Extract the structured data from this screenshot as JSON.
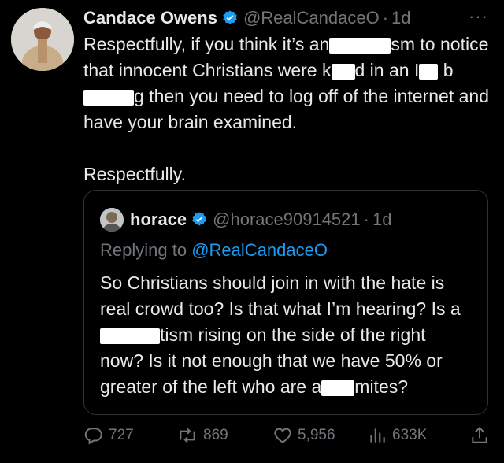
{
  "tweet": {
    "author_name": "Candace Owens",
    "handle": "@RealCandaceO",
    "separator": "·",
    "time": "1d",
    "more_label": "···",
    "paragraphs": {
      "p1_a": "Respectfully, if you think it’s an",
      "p1_b": "sm to notice that innocent Christians were k",
      "p1_c": "d in an I",
      "p1_d": " b",
      "p1_e": "g then you need to log off of the internet and have your brain examined.",
      "p2": "Respectfully."
    }
  },
  "quote": {
    "author_name": "horace",
    "handle": "@horace90914521",
    "separator": "·",
    "time": "1d",
    "replying_prefix": "Replying to ",
    "replying_handle": "@RealCandaceO",
    "text_a": "So Christians should join in with the hate is real crowd too? Is that what I’m hearing? Is a",
    "text_b": "tism rising on the side of the right now? Is it not enough that we have 50% or greater of the left who are a",
    "text_c": "mites?"
  },
  "actions": {
    "replies": "727",
    "reposts": "869",
    "likes": "5,956",
    "views": "633K"
  },
  "colors": {
    "background": "#000000",
    "text": "#e7e9ea",
    "muted": "#71767b",
    "link": "#1d9bf0",
    "border": "#2f3336",
    "verified": "#1d9bf0"
  }
}
